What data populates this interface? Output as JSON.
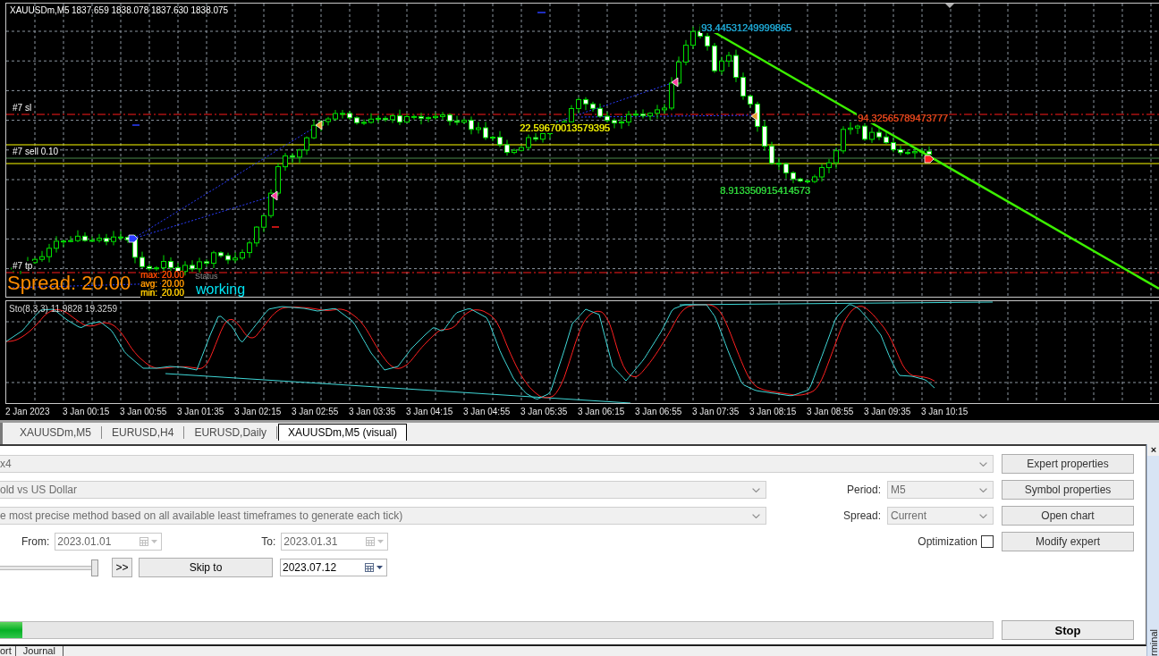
{
  "chart": {
    "title": "XAUUSDm,M5",
    "quote": "1837.659 1838.078 1837.630 1838.075",
    "order_labels": [
      "#7 sl",
      "#7 sell 0.10",
      "#7 tp"
    ],
    "value_labels": [
      {
        "text": "93.44531249999865",
        "color": "#1fa8d4"
      },
      {
        "text": "94.32565789473777",
        "color": "#e2451c"
      },
      {
        "text": "22.59670013579395",
        "color": "#e8e800"
      },
      {
        "text": "8.913350915414573",
        "color": "#2fd23a"
      }
    ],
    "spread_panel": {
      "title": "Spread: 20.00",
      "stats": [
        {
          "label": "max:",
          "value": "20.00",
          "color": "#ff4a00"
        },
        {
          "label": "avg:",
          "value": "20.00",
          "color": "#ff9800"
        },
        {
          "label": "min:",
          "value": "20.00",
          "color": "#ffcc00"
        }
      ],
      "status_label": "Status",
      "status": "working"
    },
    "indicator": {
      "label": "Sto(8,3,3) 11.9828 19.3259"
    },
    "time_axis": [
      "2 Jan 2023",
      "3 Jan 00:15",
      "3 Jan 00:55",
      "3 Jan 01:35",
      "3 Jan 02:15",
      "3 Jan 02:55",
      "3 Jan 03:35",
      "3 Jan 04:15",
      "3 Jan 04:55",
      "3 Jan 05:35",
      "3 Jan 06:15",
      "3 Jan 06:55",
      "3 Jan 07:35",
      "3 Jan 08:15",
      "3 Jan 08:55",
      "3 Jan 09:35",
      "3 Jan 10:15"
    ]
  },
  "chart_tabs": [
    {
      "label": "XAUUSDm,M5",
      "selected": false
    },
    {
      "label": "EURUSD,H4",
      "selected": false
    },
    {
      "label": "EURUSD,Daily",
      "selected": false
    },
    {
      "label": "XAUUSDm,M5 (visual)",
      "selected": true
    }
  ],
  "tester": {
    "expert": {
      "value": "x4",
      "disabled": true
    },
    "symbol": {
      "value": "old vs US Dollar",
      "disabled": true
    },
    "model": {
      "value": "e most precise method based on all available least timeframes to generate each tick)",
      "disabled": true
    },
    "period": {
      "label": "Period:",
      "value": "M5",
      "disabled": true
    },
    "spread": {
      "label": "Spread:",
      "value": "Current",
      "disabled": true
    },
    "from": {
      "label": "From:",
      "value": "2023.01.01",
      "disabled": true
    },
    "to": {
      "label": "To:",
      "value": "2023.01.31",
      "disabled": true
    },
    "optimization": {
      "label": "Optimization",
      "checked": false
    },
    "speed": {
      "level": 1
    },
    "fast_forward_button": ">>",
    "skip_button": "Skip to",
    "skip_date": {
      "value": "2023.07.12",
      "disabled": false
    },
    "progress": {
      "level": 0.0225
    },
    "side_buttons": [
      "Expert properties",
      "Symbol properties",
      "Open chart",
      "Modify expert"
    ],
    "stop_button": "Stop"
  },
  "bottom_tabs": [
    {
      "label": "ort",
      "selected": false
    },
    {
      "label": "Journal",
      "selected": false
    }
  ],
  "side_panel": {
    "close": "×",
    "title": "rminal"
  }
}
